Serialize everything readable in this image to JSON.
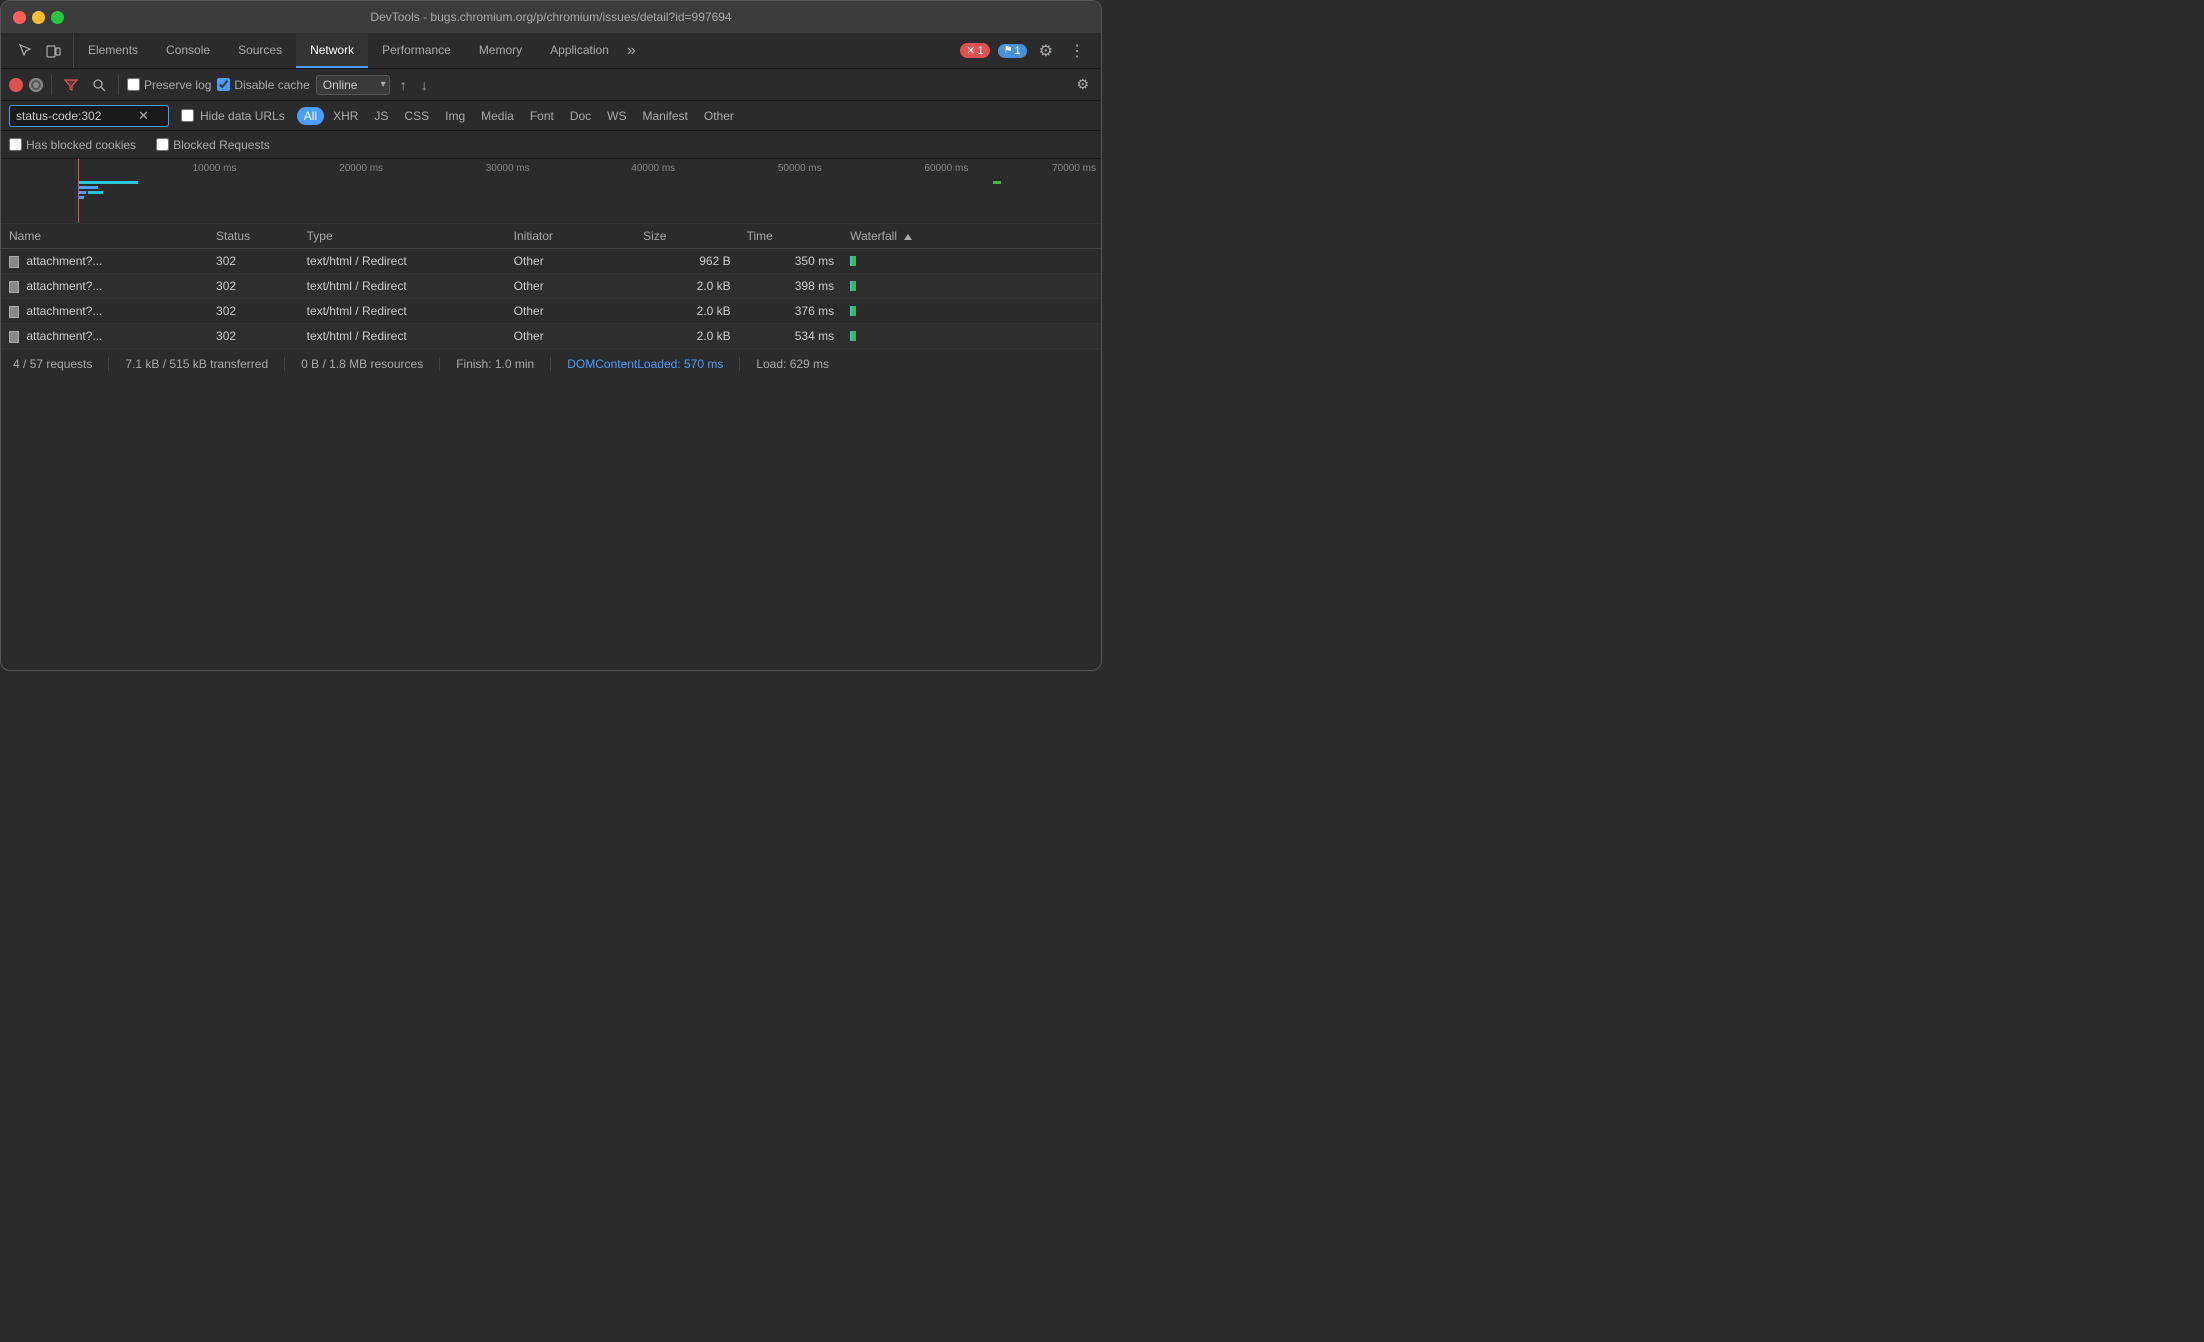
{
  "titleBar": {
    "title": "DevTools - bugs.chromium.org/p/chromium/issues/detail?id=997694"
  },
  "tabs": [
    {
      "id": "elements",
      "label": "Elements",
      "active": false
    },
    {
      "id": "console",
      "label": "Console",
      "active": false
    },
    {
      "id": "sources",
      "label": "Sources",
      "active": false
    },
    {
      "id": "network",
      "label": "Network",
      "active": true
    },
    {
      "id": "performance",
      "label": "Performance",
      "active": false
    },
    {
      "id": "memory",
      "label": "Memory",
      "active": false
    },
    {
      "id": "application",
      "label": "Application",
      "active": false
    }
  ],
  "tabBadge": {
    "errorCount": "1",
    "warningCount": "1"
  },
  "toolbar": {
    "preserveLog": "Preserve log",
    "disableCache": "Disable cache",
    "online": "Online"
  },
  "filterBar": {
    "filterValue": "status-code:302",
    "hideDataUrls": "Hide data URLs",
    "allLabel": "All",
    "types": [
      "XHR",
      "JS",
      "CSS",
      "Img",
      "Media",
      "Font",
      "Doc",
      "WS",
      "Manifest",
      "Other"
    ]
  },
  "checkboxes": {
    "hasBlockedCookies": "Has blocked cookies",
    "blockedRequests": "Blocked Requests"
  },
  "timeline": {
    "labels": [
      "10000 ms",
      "20000 ms",
      "30000 ms",
      "40000 ms",
      "50000 ms",
      "60000 ms",
      "70000 ms"
    ]
  },
  "table": {
    "columns": [
      "Name",
      "Status",
      "Type",
      "Initiator",
      "Size",
      "Time",
      "Waterfall"
    ],
    "rows": [
      {
        "name": "attachment?...",
        "status": "302",
        "type": "text/html / Redirect",
        "initiator": "Other",
        "size": "962 B",
        "time": "350 ms"
      },
      {
        "name": "attachment?...",
        "status": "302",
        "type": "text/html / Redirect",
        "initiator": "Other",
        "size": "2.0 kB",
        "time": "398 ms"
      },
      {
        "name": "attachment?...",
        "status": "302",
        "type": "text/html / Redirect",
        "initiator": "Other",
        "size": "2.0 kB",
        "time": "376 ms"
      },
      {
        "name": "attachment?...",
        "status": "302",
        "type": "text/html / Redirect",
        "initiator": "Other",
        "size": "2.0 kB",
        "time": "534 ms"
      }
    ]
  },
  "statusBar": {
    "requests": "4 / 57 requests",
    "transferred": "7.1 kB / 515 kB transferred",
    "resources": "0 B / 1.8 MB resources",
    "finish": "Finish: 1.0 min",
    "domContentLoaded": "DOMContentLoaded: 570 ms",
    "load": "Load: 629 ms"
  }
}
